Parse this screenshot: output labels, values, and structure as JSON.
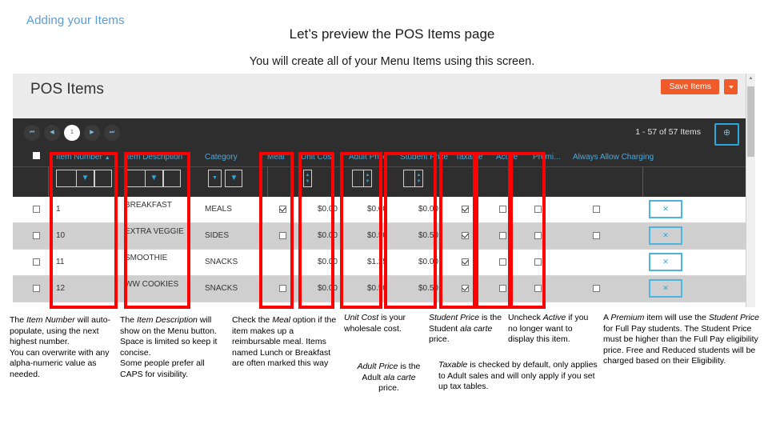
{
  "slide": {
    "kicker": "Adding your Items",
    "title": "Let’s preview the POS Items page",
    "subtitle": "You will create all of your Menu Items using this screen."
  },
  "app": {
    "page_title": "POS Items",
    "save_label": "Save Items",
    "pagination": {
      "first": "⏮",
      "prev": "◀",
      "page": "1",
      "next": "▶",
      "last": "⏭",
      "count_label": "1 - 57 of 57 Items",
      "add_label": "⊕"
    },
    "columns": [
      "Item Number",
      "Item Description",
      "Category",
      "Meal",
      "Unit Cost",
      "Adult Price",
      "Student Price",
      "Taxable",
      "Active",
      "Premi...",
      "Always Allow Charging"
    ],
    "sort_indicator": "▲",
    "filter_icon": "▼",
    "rows": [
      {
        "select": false,
        "item_number": "1",
        "item_description": "BREAKFAST",
        "category": "MEALS",
        "meal": true,
        "unit_cost": "$0.00",
        "adult_price": "$0.00",
        "student_price": "$0.00",
        "taxable": true,
        "active": false,
        "premium": false,
        "always_allow_charging": false,
        "delete_label": "✕"
      },
      {
        "select": false,
        "item_number": "10",
        "item_description": "EXTRA VEGGIE",
        "category": "SIDES",
        "meal": false,
        "unit_cost": "$0.00",
        "adult_price": "$0.50",
        "student_price": "$0.50",
        "taxable": true,
        "active": false,
        "premium": false,
        "always_allow_charging": false,
        "delete_label": "✕"
      },
      {
        "select": false,
        "item_number": "11",
        "item_description": "SMOOTHIE",
        "category": "SNACKS",
        "meal": false,
        "unit_cost": "$0.00",
        "adult_price": "$1.25",
        "student_price": "$0.00",
        "taxable": true,
        "active": false,
        "premium": false,
        "always_allow_charging": false,
        "delete_label": "✕"
      },
      {
        "select": false,
        "item_number": "12",
        "item_description": "WW COOKIES",
        "category": "SNACKS",
        "meal": false,
        "unit_cost": "$0.00",
        "adult_price": "$0.50",
        "student_price": "$0.50",
        "taxable": true,
        "active": false,
        "premium": false,
        "always_allow_charging": false,
        "delete_label": "✕"
      }
    ]
  },
  "notes": {
    "item_number": "The Item Number will auto-populate, using the next highest number. You can overwrite with any alpha-numeric value as needed.",
    "item_description": "The Item Description will show on the Menu button. Space is limited so keep it concise. Some people prefer all CAPS for visibility.",
    "meal": "Check the Meal option if the item makes up a reimbursable meal. Items named Lunch or Breakfast are often marked this way",
    "unit_cost": "Unit Cost is your wholesale cost.",
    "adult_price": "Adult Price is the Adult ala carte price.",
    "student_price": "Student Price is the Student ala carte price.",
    "active": "Uncheck Active if you no longer want to display this item.",
    "taxable": "Taxable is checked by default, only applies to Adult sales and will only apply if you set up tax tables.",
    "premium": "A Premium item will use the Student Price for Full Pay students. The Student Price must be higher than the Full Pay eligibility price. Free and Reduced students will be charged based on their Eligibility."
  },
  "colors": {
    "accent_blue": "#5B9BD5",
    "orange": "#F15A29",
    "cyan": "#29A8DF",
    "annotation_red": "#FF0000",
    "dark_chrome": "#2E2E2E"
  }
}
